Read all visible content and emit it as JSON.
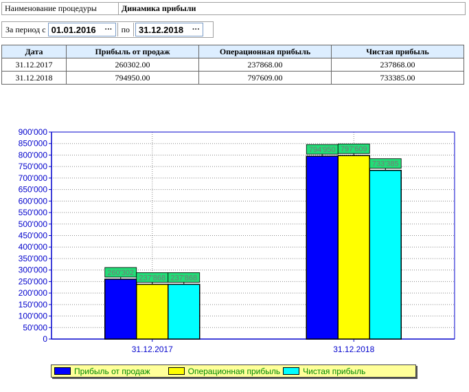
{
  "procedure": {
    "label": "Наименование процедуры",
    "value": "Динамика прибыли"
  },
  "period": {
    "from_label": "За период с",
    "from_date": "01.01.2016",
    "to_label": "по",
    "to_date": "31.12.2018",
    "picker_glyph": "···"
  },
  "table": {
    "headers": [
      "Дата",
      "Прибыль от продаж",
      "Операционная прибыль",
      "Чистая прибыль"
    ],
    "rows": [
      [
        "31.12.2017",
        "260302.00",
        "237868.00",
        "237868.00"
      ],
      [
        "31.12.2018",
        "794950.00",
        "797609.00",
        "733385.00"
      ]
    ]
  },
  "chart_data": {
    "type": "bar",
    "categories": [
      "31.12.2017",
      "31.12.2018"
    ],
    "series": [
      {
        "name": "Прибыль от продаж",
        "color": "#0000ff",
        "values": [
          260302,
          794950
        ],
        "labels": [
          "260'302",
          "794'950"
        ]
      },
      {
        "name": "Операционная прибыль",
        "color": "#ffff00",
        "values": [
          237868,
          797609
        ],
        "labels": [
          "237'868",
          "797'609"
        ]
      },
      {
        "name": "Чистая прибыль",
        "color": "#00ffff",
        "values": [
          237868,
          733385
        ],
        "labels": [
          "237'868",
          "733'385"
        ]
      }
    ],
    "ylim": [
      0,
      900000
    ],
    "ytick_step": 50000,
    "ytick_labels": [
      "0",
      "50'000",
      "100'000",
      "150'000",
      "200'000",
      "250'000",
      "300'000",
      "350'000",
      "400'000",
      "450'000",
      "500'000",
      "550'000",
      "600'000",
      "650'000",
      "700'000",
      "750'000",
      "800'000",
      "850'000",
      "900'000"
    ],
    "grid": true,
    "legend": "bottom",
    "axis_color": "#0000cc",
    "label_bg": "#22dd77"
  }
}
